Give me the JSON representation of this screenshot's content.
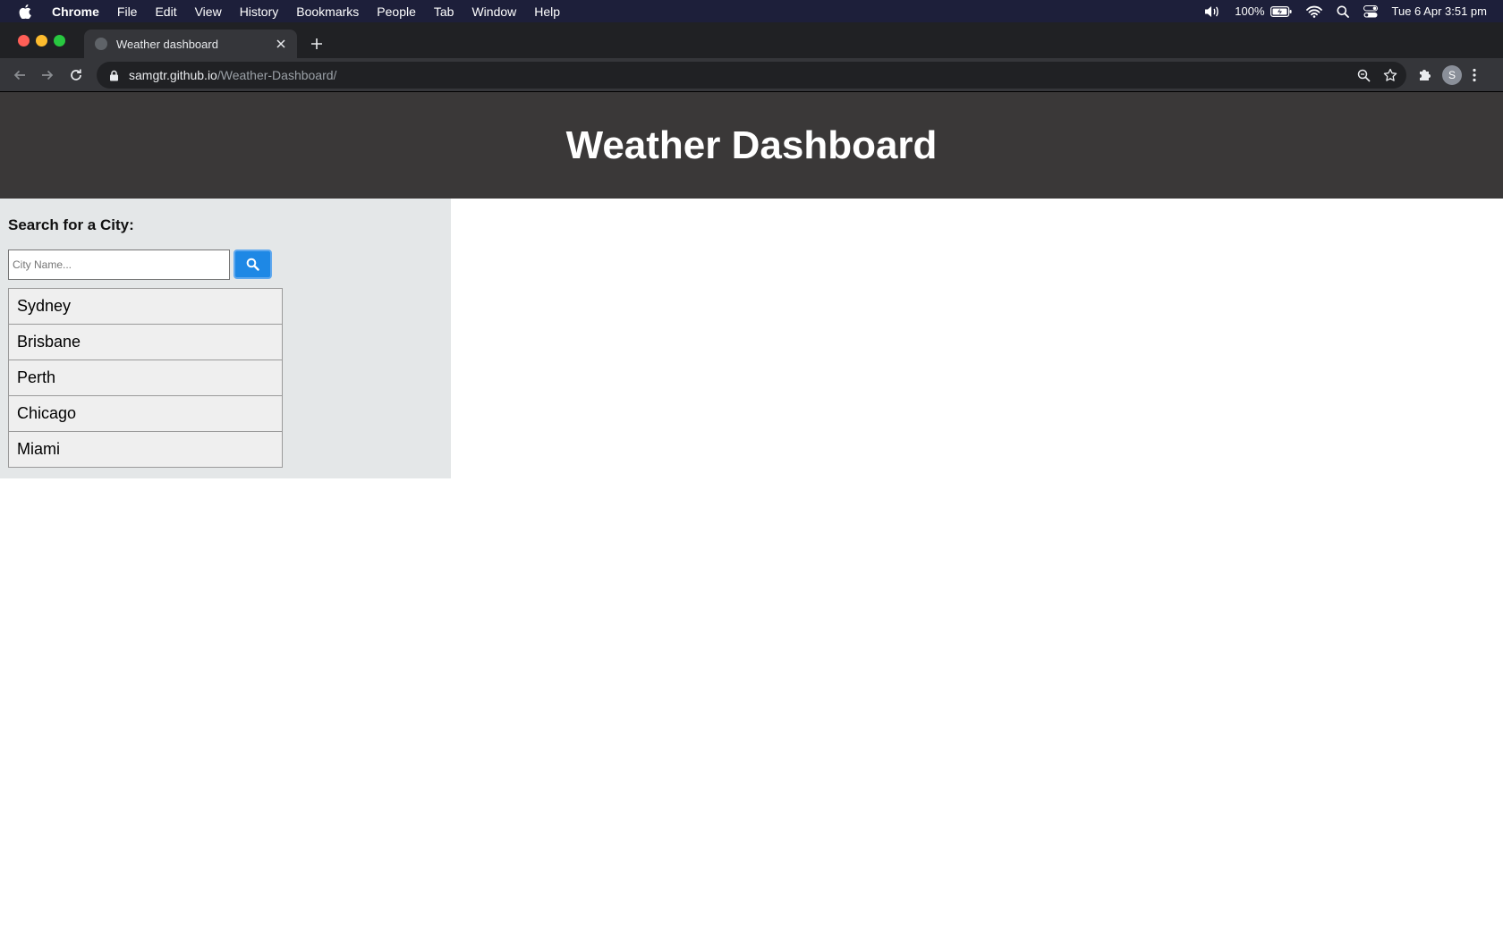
{
  "menubar": {
    "app_name": "Chrome",
    "menus": [
      "File",
      "Edit",
      "View",
      "History",
      "Bookmarks",
      "People",
      "Tab",
      "Window",
      "Help"
    ],
    "battery": "100%",
    "clock": "Tue 6 Apr  3:51 pm"
  },
  "browser": {
    "tab_title": "Weather dashboard",
    "url_host": "samgtr.github.io",
    "url_path": "/Weather-Dashboard/",
    "profile_initial": "S"
  },
  "page": {
    "title": "Weather Dashboard",
    "search": {
      "label": "Search for a City:",
      "placeholder": "City Name..."
    },
    "history": [
      "Sydney",
      "Brisbane",
      "Perth",
      "Chicago",
      "Miami"
    ]
  },
  "colors": {
    "header_bg": "#3a3838",
    "sidebar_bg": "#e4e7e8",
    "search_button": "#1e88e5"
  }
}
